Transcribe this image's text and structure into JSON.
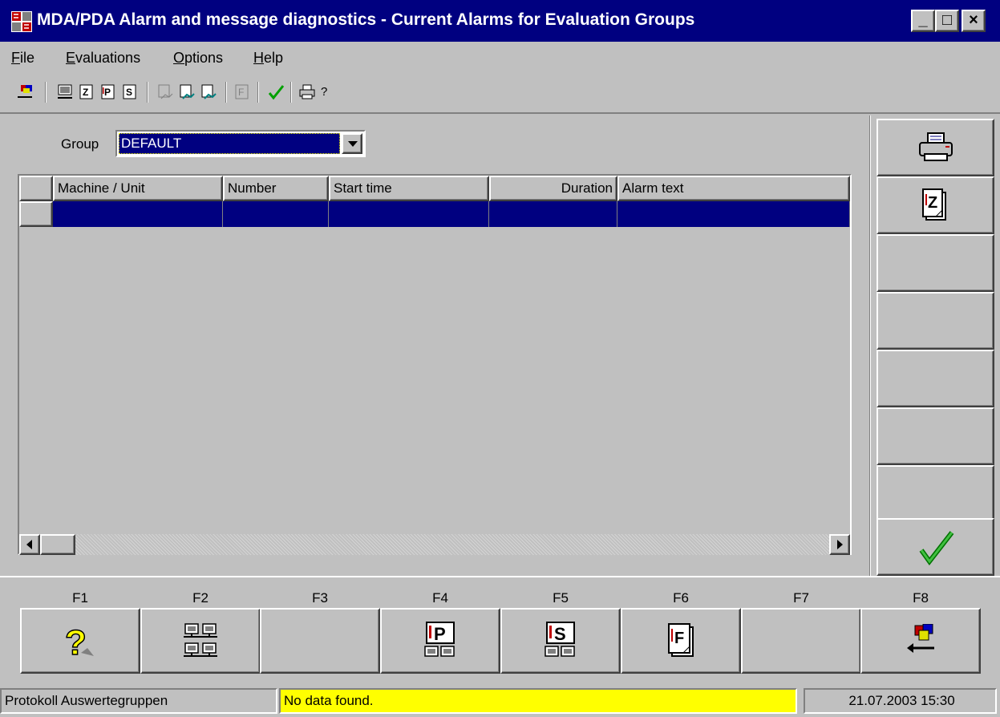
{
  "window": {
    "title": "MDA/PDA Alarm and message diagnostics - Current Alarms for Evaluation Groups",
    "controls": {
      "minimize": "_",
      "maximize": "□",
      "close": "×"
    }
  },
  "menu": [
    {
      "label_pre": "",
      "mnemonic": "F",
      "label_post": "ile"
    },
    {
      "label_pre": "",
      "mnemonic": "E",
      "label_post": "valuations"
    },
    {
      "label_pre": "",
      "mnemonic": "O",
      "label_post": "ptions"
    },
    {
      "label_pre": "",
      "mnemonic": "H",
      "label_post": "elp"
    }
  ],
  "toolbar": {
    "help_glyph": "?",
    "icons": [
      "exit-icon",
      "machines-icon",
      "report-z-icon",
      "report-p-icon",
      "report-s-icon",
      "graph-z-icon",
      "graph-p-icon",
      "graph-s-icon",
      "report-f-icon",
      "confirm-check-icon",
      "printer-icon",
      "help-icon"
    ]
  },
  "group": {
    "label": "Group",
    "value": "DEFAULT"
  },
  "grid": {
    "columns": [
      "Machine / Unit",
      "Number",
      "Start time",
      "Duration",
      "Alarm text"
    ],
    "rows": [
      [
        "",
        "",
        "",
        "",
        ""
      ]
    ]
  },
  "sidebar": {
    "buttons": [
      "printer-icon",
      "report-z-icon",
      "",
      "",
      "",
      "",
      "",
      "confirm-check-icon"
    ]
  },
  "function_keys": [
    {
      "key": "F1",
      "icon": "help-icon"
    },
    {
      "key": "F2",
      "icon": "machines-icon"
    },
    {
      "key": "F3",
      "icon": ""
    },
    {
      "key": "F4",
      "icon": "report-p-icon"
    },
    {
      "key": "F5",
      "icon": "report-s-icon"
    },
    {
      "key": "F6",
      "icon": "report-f-icon"
    },
    {
      "key": "F7",
      "icon": ""
    },
    {
      "key": "F8",
      "icon": "exit-icon"
    }
  ],
  "status": {
    "left": "Protokoll Auswertegruppen",
    "message": "No data found.",
    "datetime": "21.07.2003 15:30"
  },
  "colors": {
    "titlebar": "#000080",
    "selection": "#000080",
    "message_bg": "#ffff00",
    "face": "#c0c0c0",
    "check": "#00a000"
  }
}
